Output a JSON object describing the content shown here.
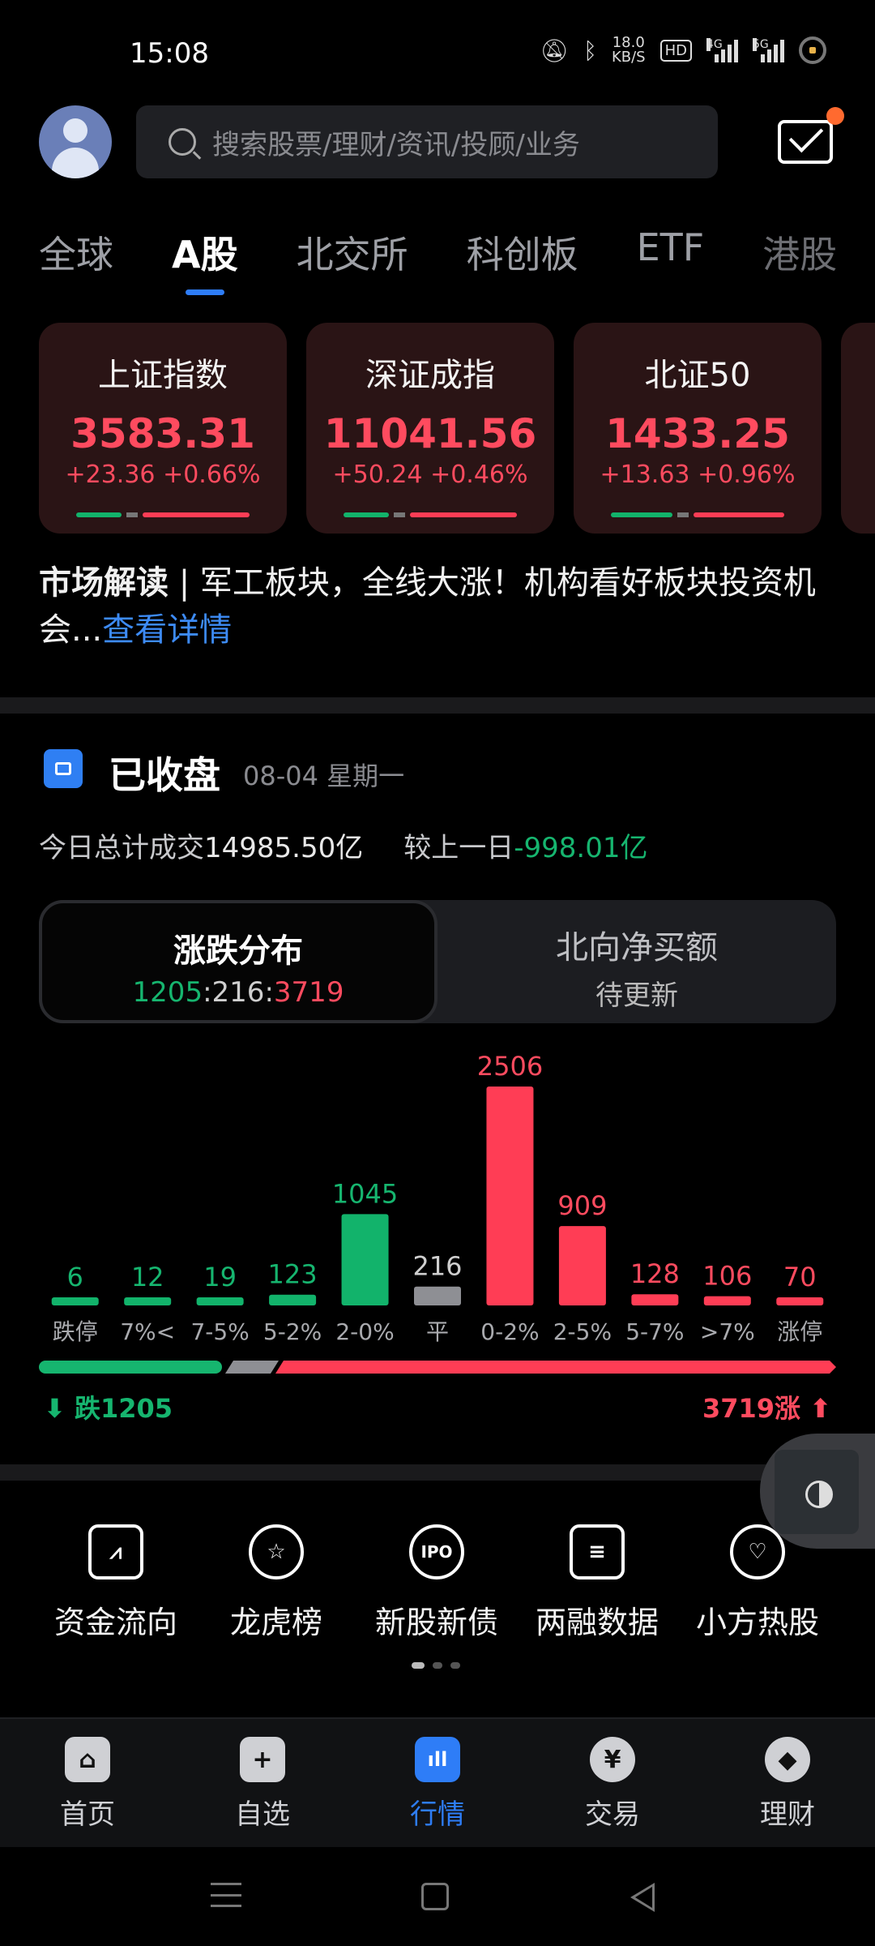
{
  "status_bar": {
    "time": "15:08",
    "net_speed_value": "18.0",
    "net_speed_unit": "KB/S",
    "hd": "HD",
    "net1": "4G",
    "net2": "5G"
  },
  "header": {
    "search_placeholder": "搜索股票/理财/资讯/投顾/业务"
  },
  "tabs": [
    "全球",
    "A股",
    "北交所",
    "科创板",
    "ETF",
    "港股"
  ],
  "active_tab_index": 1,
  "indices": [
    {
      "name": "上证指数",
      "value": "3583.31",
      "change": "+23.36",
      "pct": "+0.66%"
    },
    {
      "name": "深证成指",
      "value": "11041.56",
      "change": "+50.24",
      "pct": "+0.46%"
    },
    {
      "name": "北证50",
      "value": "1433.25",
      "change": "+13.63",
      "pct": "+0.96%"
    }
  ],
  "reading": {
    "prefix": "市场解读",
    "sep": " | ",
    "text": "军工板块，全线大涨！机构看好板块投资机会...",
    "link": "查看详情"
  },
  "closed": {
    "title": "已收盘",
    "date": "08-04 星期一",
    "turnover_label": "今日总计成交",
    "turnover_value": "14985.50亿",
    "compare_label": "较上一日",
    "compare_value": "-998.01亿"
  },
  "toggle": {
    "left_title": "涨跌分布",
    "down": "1205",
    "flat": "216",
    "up": "3719",
    "right_title": "北向净买额",
    "right_value": "待更新"
  },
  "chart_data": {
    "type": "bar",
    "categories": [
      "跌停",
      "7%<",
      "7-5%",
      "5-2%",
      "2-0%",
      "平",
      "0-2%",
      "2-5%",
      "5-7%",
      ">7%",
      "涨停"
    ],
    "values": [
      6,
      12,
      19,
      123,
      1045,
      216,
      2506,
      909,
      128,
      106,
      70
    ],
    "colors": [
      "#12b36b",
      "#12b36b",
      "#12b36b",
      "#12b36b",
      "#12b36b",
      "#8e8f94",
      "#ff3d55",
      "#ff3d55",
      "#ff3d55",
      "#ff3d55",
      "#ff3d55"
    ],
    "ylim": [
      0,
      2506
    ]
  },
  "footer": {
    "down_label": "跌1205",
    "up_label": "3719涨"
  },
  "tools": [
    {
      "label": "资金流向",
      "icon": "fund-flow-icon",
      "glyph": "⩘"
    },
    {
      "label": "龙虎榜",
      "icon": "ranking-icon",
      "glyph": "☆"
    },
    {
      "label": "新股新债",
      "icon": "ipo-icon",
      "glyph": "IPO"
    },
    {
      "label": "两融数据",
      "icon": "margin-data-icon",
      "glyph": "≡"
    },
    {
      "label": "小方热股",
      "icon": "hot-stock-icon",
      "glyph": "♡"
    }
  ],
  "nav": [
    {
      "label": "首页",
      "icon": "home-icon",
      "glyph": "⌂"
    },
    {
      "label": "自选",
      "icon": "watchlist-icon",
      "glyph": "+"
    },
    {
      "label": "行情",
      "icon": "market-icon",
      "glyph": "ıll"
    },
    {
      "label": "交易",
      "icon": "trade-icon",
      "glyph": "¥"
    },
    {
      "label": "理财",
      "icon": "wealth-icon",
      "glyph": "◆"
    }
  ],
  "active_nav_index": 2,
  "colors": {
    "up": "#ff4b5f",
    "down": "#16b56f",
    "accent": "#2e7df7"
  }
}
